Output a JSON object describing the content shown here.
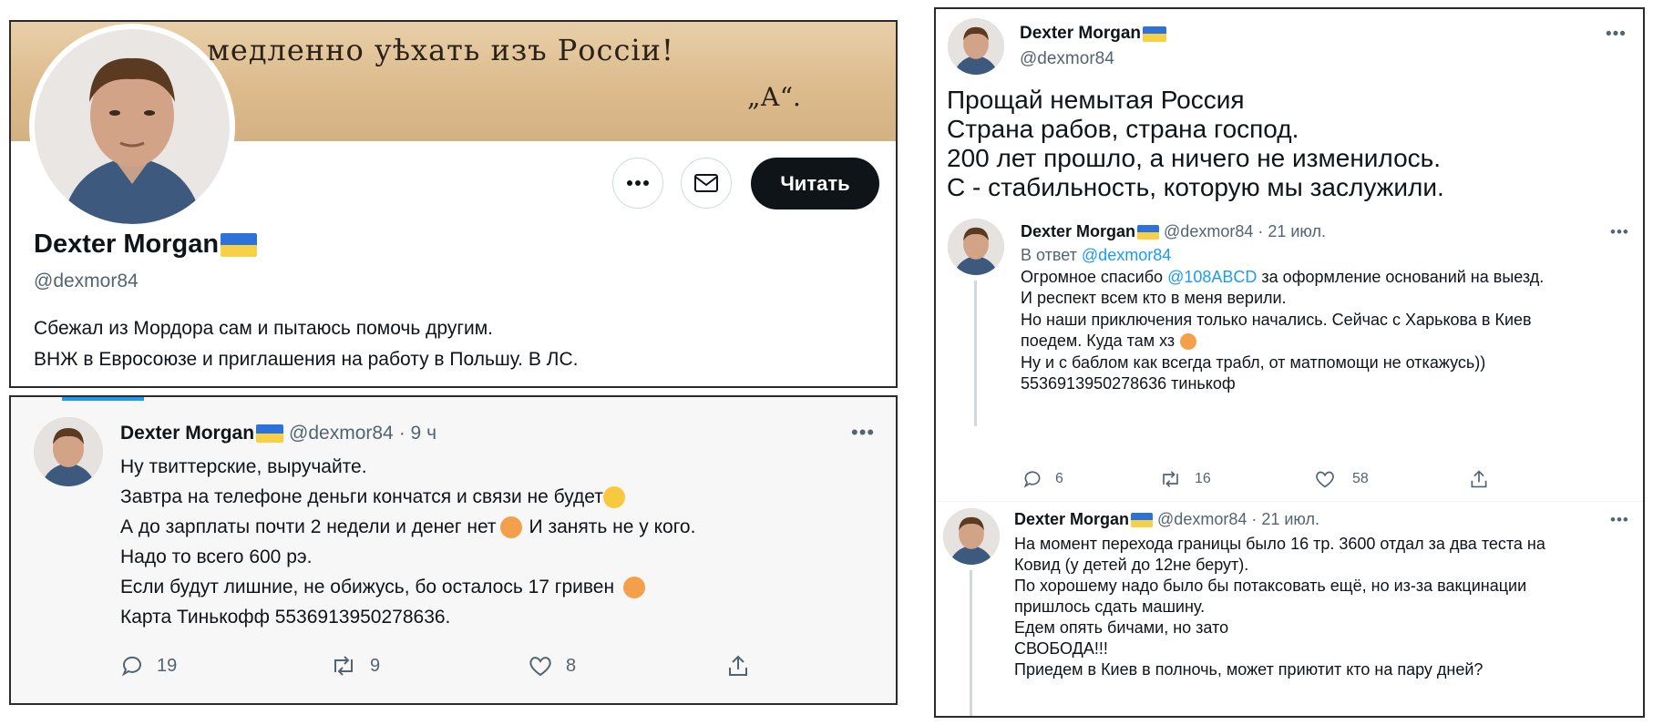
{
  "colors": {
    "flag_top": "#2d72d8",
    "flag_bottom": "#f7d046",
    "accent_link": "#1d9bf0",
    "follow_button_bg": "#0f1419"
  },
  "profile": {
    "banner_text": "медленно уѣхать изъ Россіи!",
    "banner_signature": "„А“.",
    "name": "Dexter Morgan",
    "handle": "@dexmor84",
    "bio_lines": [
      "Сбежал из Мордора сам и пытаюсь помочь другим.",
      "ВНЖ в Евросоюзе и приглашения на работу в Польшу. В ЛС."
    ],
    "follow_label": "Читать",
    "icons": {
      "more": "more-horizontal-icon",
      "message": "envelope-icon"
    }
  },
  "tweet_left": {
    "name": "Dexter Morgan",
    "handle": "@dexmor84",
    "time": "· 9 ч",
    "lines": [
      "Ну твиттерские, выручайте.",
      "Завтра на телефоне деньги кончатся и связи не будет",
      "А до зарплаты почти 2 недели и денег нет",
      "И занять не у кого.",
      "Надо то всего 600 рэ.",
      "Если будут лишние, не обижусь, бо осталось 17 гривен",
      "Карта Тинькофф 5536913950278636."
    ],
    "actions": {
      "replies": "19",
      "retweets": "9",
      "likes": "8"
    }
  },
  "thread_main": {
    "name": "Dexter Morgan",
    "handle": "@dexmor84",
    "lines": [
      "Прощай немытая Россия",
      "Страна рабов, страна господ.",
      "200 лет прошло, а ничего не изменилось.",
      "С - стабильность, которую мы заслужили."
    ]
  },
  "thread_reply1": {
    "name": "Dexter Morgan",
    "handle": "@dexmor84",
    "time": "· 21 июл.",
    "reply_prefix": "В ответ",
    "reply_to": "@dexmor84",
    "line1_start": "Огромное спасибо",
    "line1_mention": "@108ABCD",
    "line1_end": "за оформление оснований на выезд.",
    "lines": [
      "И респект всем кто в меня верили.",
      "Но наши приключения только начались. Сейчас с Харькова в Киев",
      "поедем. Куда там хз",
      "Ну и с баблом как всегда трабл, от матпомощи не откажусь))",
      "5536913950278636 тинькоф"
    ],
    "actions": {
      "replies": "6",
      "retweets": "16",
      "likes": "58"
    }
  },
  "thread_reply2": {
    "name": "Dexter Morgan",
    "handle": "@dexmor84",
    "time": "· 21 июл.",
    "lines": [
      "На момент перехода границы было 16 тр. 3600 отдал за два теста на",
      "Ковид (у детей до 12не берут).",
      "По хорошему надо было бы потаксовать ещё, но из-за вакцинации",
      "пришлось сдать машину.",
      "Едем опять бичами, но зато",
      "СВОБОДА!!!",
      "Приедем в Киев в полночь, может приютит кто на пару дней?"
    ]
  }
}
